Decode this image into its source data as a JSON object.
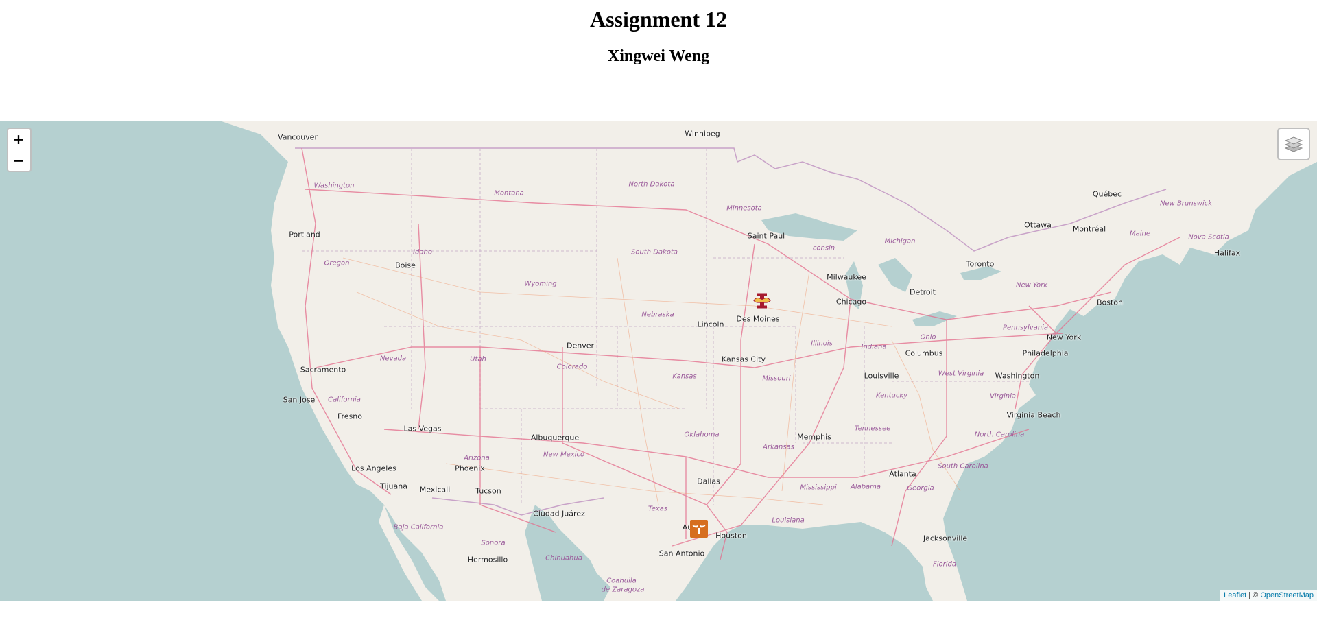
{
  "header": {
    "title": "Assignment 12",
    "subtitle": "Xingwei Weng"
  },
  "map": {
    "zoom_in_label": "+",
    "zoom_out_label": "−",
    "layers_icon": "layers-icon",
    "attribution": {
      "leaflet": "Leaflet",
      "separator": " | © ",
      "osm": "OpenStreetMap"
    },
    "colors": {
      "water": "#b5d0d0",
      "land": "#f2efe9",
      "roads": "#e46b8b",
      "borders": "#c8a2c8"
    },
    "cities": [
      {
        "name": "Vancouver"
      },
      {
        "name": "Winnipeg"
      },
      {
        "name": "Québec"
      },
      {
        "name": "Portland"
      },
      {
        "name": "Saint Paul"
      },
      {
        "name": "Ottawa"
      },
      {
        "name": "Montréal"
      },
      {
        "name": "Boise"
      },
      {
        "name": "Toronto"
      },
      {
        "name": "Halifax"
      },
      {
        "name": "Milwaukee"
      },
      {
        "name": "Detroit"
      },
      {
        "name": "Chicago"
      },
      {
        "name": "Des Moines"
      },
      {
        "name": "Lincoln"
      },
      {
        "name": "Boston"
      },
      {
        "name": "New York"
      },
      {
        "name": "Denver"
      },
      {
        "name": "Kansas City"
      },
      {
        "name": "Columbus"
      },
      {
        "name": "Philadelphia"
      },
      {
        "name": "Sacramento"
      },
      {
        "name": "Louisville"
      },
      {
        "name": "Washington"
      },
      {
        "name": "San Jose"
      },
      {
        "name": "Fresno"
      },
      {
        "name": "Virginia Beach"
      },
      {
        "name": "Las Vegas"
      },
      {
        "name": "Albuquerque"
      },
      {
        "name": "Memphis"
      },
      {
        "name": "Phoenix"
      },
      {
        "name": "Los Angeles"
      },
      {
        "name": "Atlanta"
      },
      {
        "name": "Dallas"
      },
      {
        "name": "Tijuana"
      },
      {
        "name": "Mexicali"
      },
      {
        "name": "Tucson"
      },
      {
        "name": "Ciudad Juárez"
      },
      {
        "name": "Houston"
      },
      {
        "name": "Jacksonville"
      },
      {
        "name": "San Antonio"
      },
      {
        "name": "Hermosillo"
      },
      {
        "name": "Au"
      }
    ],
    "regions": [
      {
        "name": "Washington"
      },
      {
        "name": "North Dakota"
      },
      {
        "name": "Montana"
      },
      {
        "name": "Minnesota"
      },
      {
        "name": "New Brunswick"
      },
      {
        "name": "Maine"
      },
      {
        "name": "Nova Scotia"
      },
      {
        "name": "Idaho"
      },
      {
        "name": "South Dakota"
      },
      {
        "name": "consin"
      },
      {
        "name": "Michigan"
      },
      {
        "name": "Oregon"
      },
      {
        "name": "Wyoming"
      },
      {
        "name": "New York"
      },
      {
        "name": "Nebraska"
      },
      {
        "name": "Pennsylvania"
      },
      {
        "name": "Ohio"
      },
      {
        "name": "Illinois"
      },
      {
        "name": "Indiana"
      },
      {
        "name": "Nevada"
      },
      {
        "name": "Utah"
      },
      {
        "name": "Colorado"
      },
      {
        "name": "Kansas"
      },
      {
        "name": "Missouri"
      },
      {
        "name": "West Virginia"
      },
      {
        "name": "California"
      },
      {
        "name": "Kentucky"
      },
      {
        "name": "Virginia"
      },
      {
        "name": "Oklahoma"
      },
      {
        "name": "Tennessee"
      },
      {
        "name": "North Carolina"
      },
      {
        "name": "Arizona"
      },
      {
        "name": "Arkansas"
      },
      {
        "name": "New Mexico"
      },
      {
        "name": "South Carolina"
      },
      {
        "name": "Mississippi"
      },
      {
        "name": "Alabama"
      },
      {
        "name": "Georgia"
      },
      {
        "name": "Texas"
      },
      {
        "name": "Louisiana"
      },
      {
        "name": "Baja California"
      },
      {
        "name": "Sonora"
      },
      {
        "name": "Chihuahua"
      },
      {
        "name": "Florida"
      },
      {
        "name": "Coahuila"
      },
      {
        "name": "de Zaragoza"
      }
    ],
    "markers": [
      {
        "name": "Iowa State University",
        "icon": "iowa-state-logo-icon",
        "near": "Des Moines"
      },
      {
        "name": "University of Texas",
        "icon": "longhorn-logo-icon",
        "near": "Austin"
      }
    ]
  }
}
